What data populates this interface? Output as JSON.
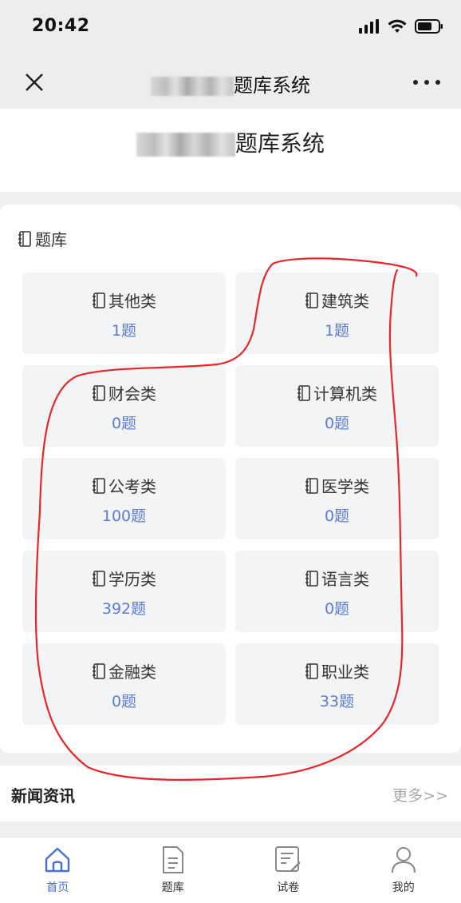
{
  "status_bar": {
    "time": "20:42"
  },
  "nav": {
    "title": "题库系统"
  },
  "header": {
    "title": "题库系统"
  },
  "bank": {
    "section_title": "题库",
    "categories": [
      {
        "name": "其他类",
        "count": "1题"
      },
      {
        "name": "建筑类",
        "count": "1题"
      },
      {
        "name": "财会类",
        "count": "0题"
      },
      {
        "name": "计算机类",
        "count": "0题"
      },
      {
        "name": "公考类",
        "count": "100题"
      },
      {
        "name": "医学类",
        "count": "0题"
      },
      {
        "name": "学历类",
        "count": "392题"
      },
      {
        "name": "语言类",
        "count": "0题"
      },
      {
        "name": "金融类",
        "count": "0题"
      },
      {
        "name": "职业类",
        "count": "33题"
      }
    ]
  },
  "news": {
    "title": "新闻资讯",
    "more": "更多>>"
  },
  "tabs": [
    {
      "label": "首页",
      "icon": "home-icon",
      "active": true
    },
    {
      "label": "题库",
      "icon": "document-icon",
      "active": false
    },
    {
      "label": "试卷",
      "icon": "exam-edit-icon",
      "active": false
    },
    {
      "label": "我的",
      "icon": "user-icon",
      "active": false
    }
  ],
  "colors": {
    "accent": "#4a6fd6",
    "count_text": "#5b7bd5",
    "annotation": "#e8262a",
    "tile_bg": "#f3f4f6"
  }
}
